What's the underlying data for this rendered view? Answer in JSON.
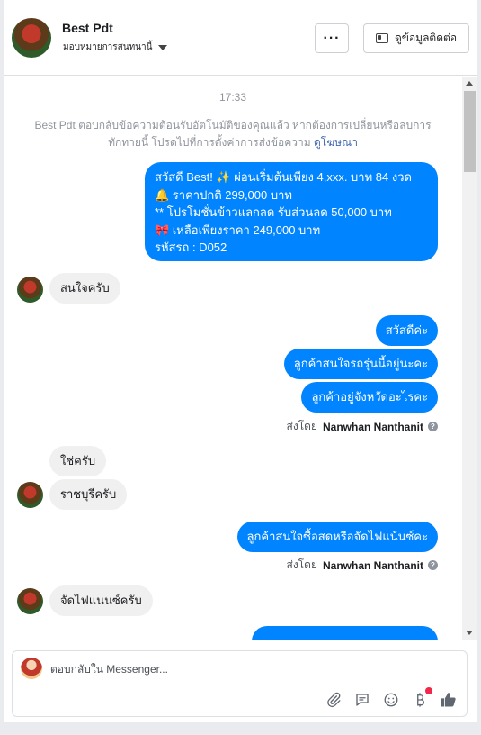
{
  "header": {
    "contact_name": "Best Pdt",
    "assign_label": "มอบหมายการสนทนานี้",
    "more_label": "···",
    "view_contact_label": "ดูข้อมูลติดต่อ"
  },
  "chat": {
    "timestamp": "17:33",
    "notice_text": "Best Pdt ตอบกลับข้อความต้อนรับอัตโนมัติของคุณแล้ว หากต้องการเปลี่ยนหรือลบการทักทายนี้ โปรดไปที่การตั้งค่าการส่งข้อความ",
    "notice_link": "ดูโฆษณา",
    "promo_lines": [
      "สวัสดี Best! ✨  ผ่อนเริ่มต้นเพียง 4,xxx. บาท 84 งวด",
      "🔔 ราคาปกติ  299,000 บาท",
      "** โปรโมชั่นข้าวแลกลด รับส่วนลด 50,000 บาท",
      "🎀  เหลือเพียงราคา 249,000 บาท",
      " รหัสรถ : D052"
    ],
    "msg_in_1": "สนใจครับ",
    "msg_out_1": "สวัสดีค่ะ",
    "msg_out_2": "ลูกค้าสนใจรถรุ่นนี้อยู่นะคะ",
    "msg_out_3": "ลูกค้าอยู่จังหวัดอะไรคะ",
    "sent_by_label": "ส่งโดย",
    "sent_by_name": "Nanwhan Nanthanit",
    "msg_in_2": "ใช่ครับ",
    "msg_in_3": "ราชบุรีครับ",
    "msg_out_4": "ลูกค้าสนใจซื้อสดหรือจัดไฟแน้นซ์คะ",
    "msg_in_4": "จัดไฟแนนซ์ครับ"
  },
  "composer": {
    "placeholder": "ตอบกลับใน Messenger...",
    "icons": [
      "attachment-icon",
      "saved-reply-icon",
      "emoji-icon",
      "payment-icon",
      "like-icon"
    ]
  },
  "colors": {
    "outgoing_bubble": "#0084ff",
    "incoming_bubble": "#f1f0f0",
    "link": "#4267b2",
    "notification_dot": "#f02849"
  }
}
